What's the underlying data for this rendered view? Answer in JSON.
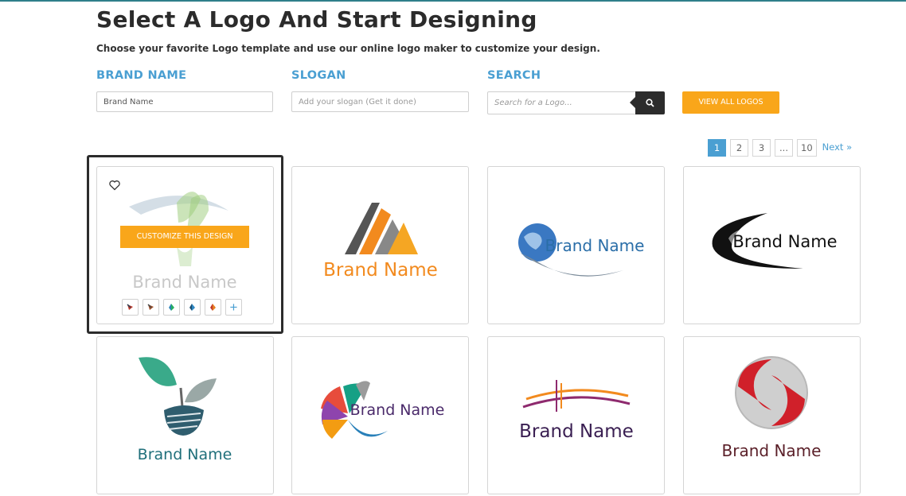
{
  "header": {
    "title": "Select A Logo And Start Designing",
    "subtitle": "Choose your favorite Logo template and use our online logo maker to customize your design."
  },
  "fields": {
    "brand_label": "BRAND NAME",
    "brand_value": "Brand Name",
    "slogan_label": "SLOGAN",
    "slogan_placeholder": "Add your slogan (Get it done)",
    "search_label": "SEARCH",
    "search_placeholder": "Search for a Logo..."
  },
  "buttons": {
    "view_all": "VIEW ALL LOGOS",
    "customize": "CUSTOMIZE THIS DESIGN"
  },
  "pagination": {
    "pages": [
      "1",
      "2",
      "3",
      "...",
      "10"
    ],
    "active": "1",
    "next": "Next »"
  },
  "logos": {
    "brand_text": "Brand Name",
    "cards": [
      {
        "style": "leaf-swoosh-faded",
        "text_color": "#c8c8c8"
      },
      {
        "style": "triangle-stripes",
        "text_color": "#f28a1e"
      },
      {
        "style": "globe-swoosh",
        "text_color": "#2a6ea8"
      },
      {
        "style": "black-crescent",
        "text_color": "#111111"
      },
      {
        "style": "leaf-sprout",
        "text_color": "#1f6f7a"
      },
      {
        "style": "colorful-fan",
        "text_color": "#4a2a6a"
      },
      {
        "style": "orange-purple-lines",
        "text_color": "#3a1f52"
      },
      {
        "style": "red-s-sphere",
        "text_color": "#5a1f28"
      }
    ]
  },
  "swatch_count": 5
}
